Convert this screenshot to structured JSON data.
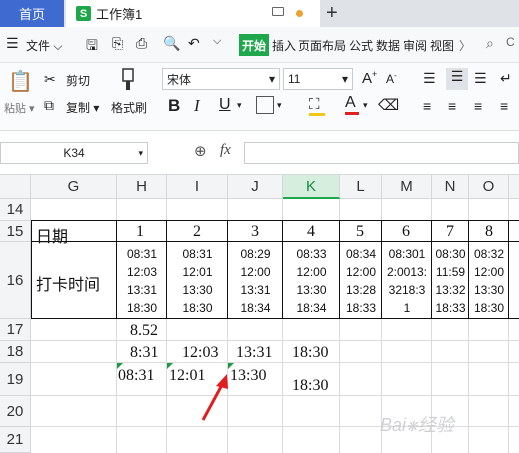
{
  "tabs": {
    "home": "首页",
    "doc": "工作簿1"
  },
  "menu": {
    "file": "文件",
    "items": [
      "开始",
      "插入",
      "页面布局",
      "公式",
      "数据",
      "审阅",
      "视图"
    ]
  },
  "ribbon": {
    "paste": "粘贴",
    "cut": "剪切",
    "copy": "复制",
    "format_painter": "格式刷",
    "font": "宋体",
    "size": "11",
    "bold": "B",
    "italic": "I",
    "underline": "U",
    "font_color_letter": "A"
  },
  "formula": {
    "cell_ref": "K34",
    "fx": "fx"
  },
  "columns": [
    "G",
    "H",
    "I",
    "J",
    "K",
    "L",
    "M",
    "N",
    "O"
  ],
  "rows": [
    "14",
    "15",
    "16",
    "17",
    "18",
    "19",
    "20",
    "21"
  ],
  "row15": {
    "label": "日期",
    "days": [
      "1",
      "2",
      "3",
      "4",
      "5",
      "6",
      "7",
      "8"
    ]
  },
  "row16": {
    "label": "打卡时间",
    "times": [
      "08:31\n12:03\n13:31\n18:30",
      "08:31\n12:01\n13:30\n18:30",
      "08:29\n12:00\n13:31\n18:34",
      "08:33\n12:00\n13:30\n18:34",
      "08:34\n12:00\n13:28\n18:33",
      "08:301\n2:0013:\n3218:3\n1",
      "08:30\n11:59\n13:32\n18:33",
      "08:32\n12:00\n13:30\n18:30"
    ]
  },
  "row17": {
    "H": "8.52"
  },
  "row18": {
    "H": "8:31",
    "I": "12:03",
    "J": "13:31",
    "K": "18:30"
  },
  "row19": {
    "H": "08:31",
    "I": "12:01",
    "J": "13:30",
    "K": "18:30"
  },
  "colors": {
    "accent": "#1fa84b",
    "home_tab": "#3f6bd1",
    "arrow": "#e02020",
    "selected_col": "#1fa84b"
  }
}
